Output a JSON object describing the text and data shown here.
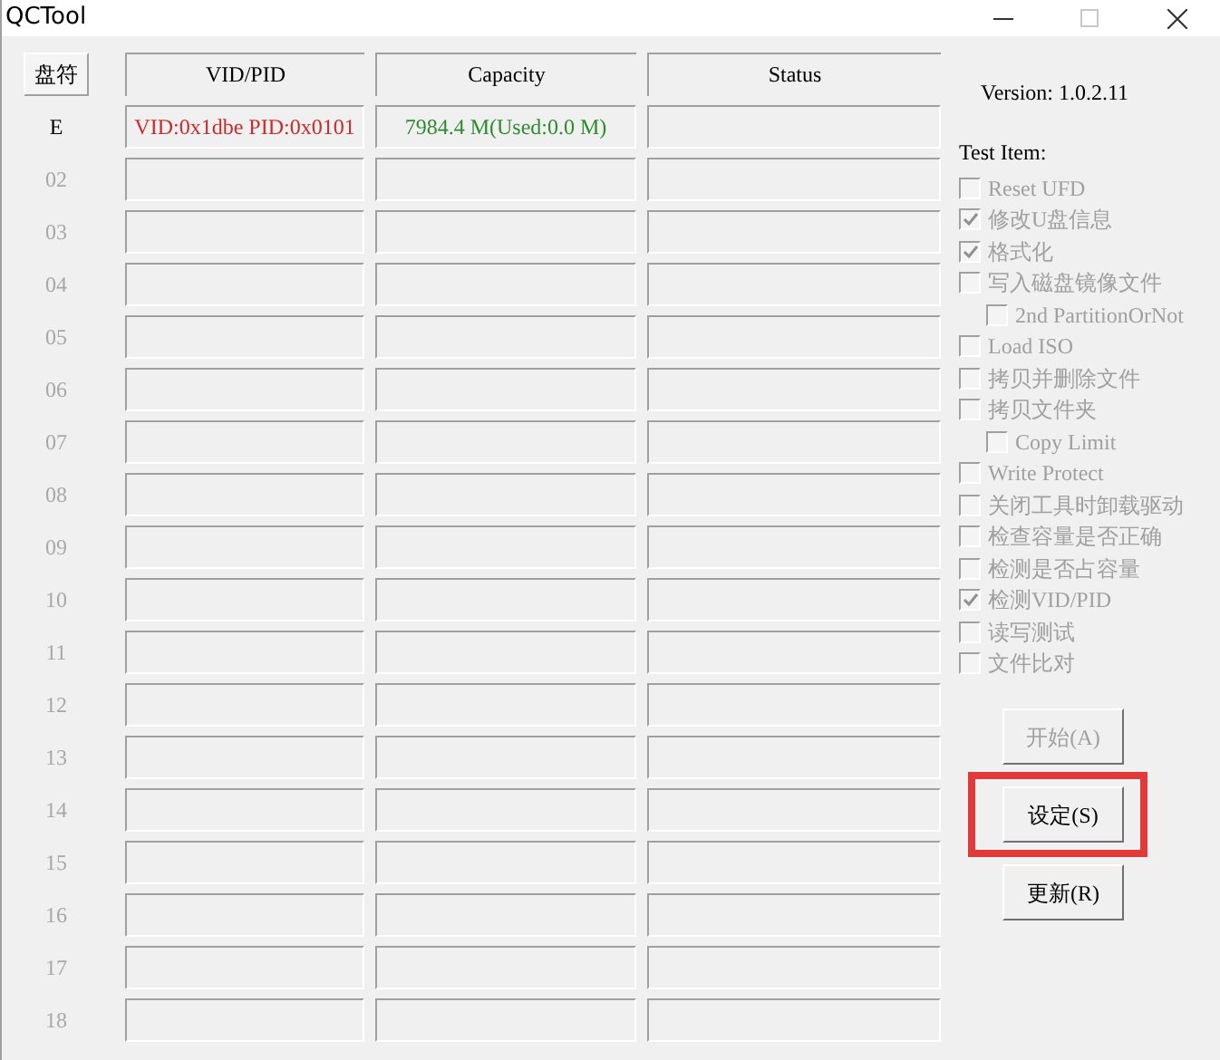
{
  "window": {
    "title": "QCTool",
    "controls": [
      {
        "kind": "minimize",
        "disabled": false
      },
      {
        "kind": "maximize",
        "disabled": true
      },
      {
        "kind": "close",
        "disabled": false
      }
    ]
  },
  "table": {
    "columns": [
      "盘符",
      "VID/PID",
      "Capacity",
      "Status"
    ],
    "rows": [
      {
        "drive": "E",
        "disabled": false,
        "vid_pid": "VID:0x1dbe PID:0x0101",
        "capacity": "7984.4 M(Used:0.0 M)"
      },
      {
        "drive": "02",
        "disabled": true
      },
      {
        "drive": "03",
        "disabled": true
      },
      {
        "drive": "04",
        "disabled": true
      },
      {
        "drive": "05",
        "disabled": true
      },
      {
        "drive": "06",
        "disabled": true
      },
      {
        "drive": "07",
        "disabled": true
      },
      {
        "drive": "08",
        "disabled": true
      },
      {
        "drive": "09",
        "disabled": true
      },
      {
        "drive": "10",
        "disabled": true
      },
      {
        "drive": "11",
        "disabled": true
      },
      {
        "drive": "12",
        "disabled": true
      },
      {
        "drive": "13",
        "disabled": true
      },
      {
        "drive": "14",
        "disabled": true
      },
      {
        "drive": "15",
        "disabled": true
      },
      {
        "drive": "16",
        "disabled": true
      },
      {
        "drive": "17",
        "disabled": true
      },
      {
        "drive": "18",
        "disabled": true
      }
    ]
  },
  "side": {
    "version": "Version: 1.0.2.11",
    "test_item_label": "Test Item:",
    "test_items": [
      {
        "label": "Reset UFD",
        "checked": false,
        "disabled": true
      },
      {
        "label": "修改U盘信息",
        "checked": true,
        "disabled": true
      },
      {
        "label": "格式化",
        "checked": true,
        "disabled": true
      },
      {
        "label": "写入磁盘镜像文件",
        "checked": false,
        "disabled": true,
        "children": [
          {
            "label": "2nd PartitionOrNot",
            "checked": false,
            "disabled": true
          }
        ]
      },
      {
        "label": "Load ISO",
        "checked": false,
        "disabled": true
      },
      {
        "label": "拷贝并删除文件",
        "checked": false,
        "disabled": true
      },
      {
        "label": "拷贝文件夹",
        "checked": false,
        "disabled": true,
        "children": [
          {
            "label": "Copy Limit",
            "checked": false,
            "disabled": true
          }
        ]
      },
      {
        "label": "Write Protect",
        "checked": false,
        "disabled": true
      },
      {
        "label": "关闭工具时卸载驱动",
        "checked": false,
        "disabled": true
      },
      {
        "label": "检查容量是否正确",
        "checked": false,
        "disabled": true
      },
      {
        "label": "检测是否占容量",
        "checked": false,
        "disabled": true
      },
      {
        "label": "检测VID/PID",
        "checked": true,
        "disabled": true
      },
      {
        "label": "读写测试",
        "checked": false,
        "disabled": true
      },
      {
        "label": "文件比对",
        "checked": false,
        "disabled": true
      }
    ],
    "buttons": [
      {
        "label": "开始(A)",
        "disabled": true,
        "highlighted": false
      },
      {
        "label": "设定(S)",
        "disabled": false,
        "highlighted": true
      },
      {
        "label": "更新(R)",
        "disabled": false,
        "highlighted": false
      }
    ]
  }
}
